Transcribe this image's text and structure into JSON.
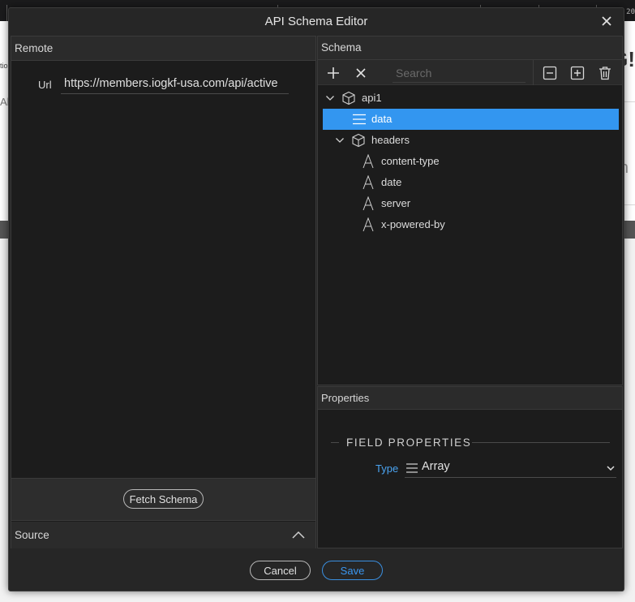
{
  "background": {
    "corner_number": "20",
    "left_fragment_top": "tio",
    "left_fragment_mid": "Ab",
    "right_fragment_top": "G!",
    "right_fragment_mid": "n"
  },
  "dialog": {
    "title": "API Schema Editor"
  },
  "remote": {
    "header": "Remote",
    "url_label": "Url",
    "url_value": "https://members.iogkf-usa.com/api/active",
    "fetch_button": "Fetch Schema"
  },
  "source": {
    "label": "Source"
  },
  "schema": {
    "header": "Schema",
    "search_placeholder": "Search",
    "tree": [
      {
        "label": "api1",
        "icon": "cube-icon",
        "depth": 0,
        "expanded": true,
        "selected": false
      },
      {
        "label": "data",
        "icon": "array-icon",
        "depth": 1,
        "expanded": null,
        "selected": true
      },
      {
        "label": "headers",
        "icon": "cube-icon",
        "depth": 1,
        "expanded": true,
        "selected": false
      },
      {
        "label": "content-type",
        "icon": "text-icon",
        "depth": 2,
        "expanded": null,
        "selected": false
      },
      {
        "label": "date",
        "icon": "text-icon",
        "depth": 2,
        "expanded": null,
        "selected": false
      },
      {
        "label": "server",
        "icon": "text-icon",
        "depth": 2,
        "expanded": null,
        "selected": false
      },
      {
        "label": "x-powered-by",
        "icon": "text-icon",
        "depth": 2,
        "expanded": null,
        "selected": false
      }
    ]
  },
  "properties": {
    "header": "Properties",
    "section_title": "FIELD PROPERTIES",
    "type_label": "Type",
    "type_value": "Array"
  },
  "footer": {
    "cancel_label": "Cancel",
    "save_label": "Save"
  },
  "colors": {
    "selection": "#3396f0",
    "accent": "#3a96f0",
    "dialog_bg": "#262626",
    "panel_bg": "#1c1c1c"
  }
}
